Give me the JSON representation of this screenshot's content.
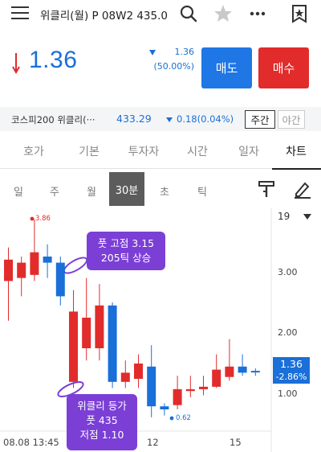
{
  "header": {
    "title": "위클리(월) P 08W2 435.0",
    "menu_icon": "hamburger-menu-icon",
    "search_icon": "search-icon",
    "favorite_icon": "star-icon",
    "more_icon": "more-dots-icon",
    "bookmark_icon": "bookmark-star-icon"
  },
  "quote": {
    "price": "1.36",
    "direction": "down",
    "change": "1.36",
    "change_pct": "(50.00%)",
    "sell_label": "매도",
    "buy_label": "매수",
    "up_color": "#e22b2b",
    "down_color": "#1a6fd8"
  },
  "index_bar": {
    "name": "코스피200 위클리(···",
    "value": "433.29",
    "change": "0.18(0.04%)",
    "session_day": "주간",
    "session_night": "야간"
  },
  "tabs": [
    "호가",
    "기본",
    "투자자",
    "시간",
    "일자",
    "차트"
  ],
  "active_tab": "차트",
  "periods": [
    "일",
    "주",
    "월",
    "30분",
    "초",
    "틱"
  ],
  "selected_period": "30분",
  "chart_toolbar": {
    "indicator_icon": "indicator-tool-icon",
    "draw_icon": "drawing-pen-icon",
    "interval": "19",
    "dropdown_icon": "dropdown-arrow-icon"
  },
  "chart_data": {
    "type": "candlestick",
    "y_ticks": [
      "3.00",
      "2.00",
      "1.00"
    ],
    "x_ticks": [
      "08.08 13:45",
      "12",
      "15"
    ],
    "max_label": "3.86",
    "min_label": "0.62",
    "last_price": "1.36",
    "last_change": "-2.86%",
    "ylim": [
      0.4,
      4.0
    ],
    "candles": [
      {
        "o": 2.85,
        "h": 3.4,
        "l": 2.2,
        "c": 3.2
      },
      {
        "o": 2.9,
        "h": 3.25,
        "l": 2.6,
        "c": 3.15
      },
      {
        "o": 2.95,
        "h": 3.86,
        "l": 2.85,
        "c": 3.32
      },
      {
        "o": 3.25,
        "h": 3.45,
        "l": 2.9,
        "c": 3.15
      },
      {
        "o": 3.15,
        "h": 3.25,
        "l": 2.45,
        "c": 2.6
      },
      {
        "o": 1.2,
        "h": 2.7,
        "l": 1.1,
        "c": 2.35
      },
      {
        "o": 1.75,
        "h": 2.9,
        "l": 1.55,
        "c": 2.25
      },
      {
        "o": 1.75,
        "h": 2.8,
        "l": 1.55,
        "c": 2.45
      },
      {
        "o": 2.45,
        "h": 2.5,
        "l": 1.1,
        "c": 1.2
      },
      {
        "o": 1.2,
        "h": 1.55,
        "l": 1.1,
        "c": 1.35
      },
      {
        "o": 1.25,
        "h": 1.65,
        "l": 1.1,
        "c": 1.5
      },
      {
        "o": 1.45,
        "h": 1.8,
        "l": 0.62,
        "c": 0.8
      },
      {
        "o": 0.8,
        "h": 0.85,
        "l": 0.65,
        "c": 0.75
      },
      {
        "o": 0.82,
        "h": 1.3,
        "l": 0.75,
        "c": 1.08
      },
      {
        "o": 1.05,
        "h": 1.3,
        "l": 0.95,
        "c": 1.08
      },
      {
        "o": 1.08,
        "h": 1.3,
        "l": 0.98,
        "c": 1.12
      },
      {
        "o": 1.12,
        "h": 1.65,
        "l": 1.1,
        "c": 1.4
      },
      {
        "o": 1.28,
        "h": 1.9,
        "l": 1.22,
        "c": 1.45
      },
      {
        "o": 1.45,
        "h": 1.65,
        "l": 1.3,
        "c": 1.35
      },
      {
        "o": 1.38,
        "h": 1.42,
        "l": 1.3,
        "c": 1.36
      }
    ],
    "annotations": [
      {
        "line1": "풋 고점 3.15",
        "line2": "205틱 상승"
      },
      {
        "line1": "위클리 등가",
        "line2": "풋 435",
        "line3": "저점 1.10"
      }
    ]
  }
}
